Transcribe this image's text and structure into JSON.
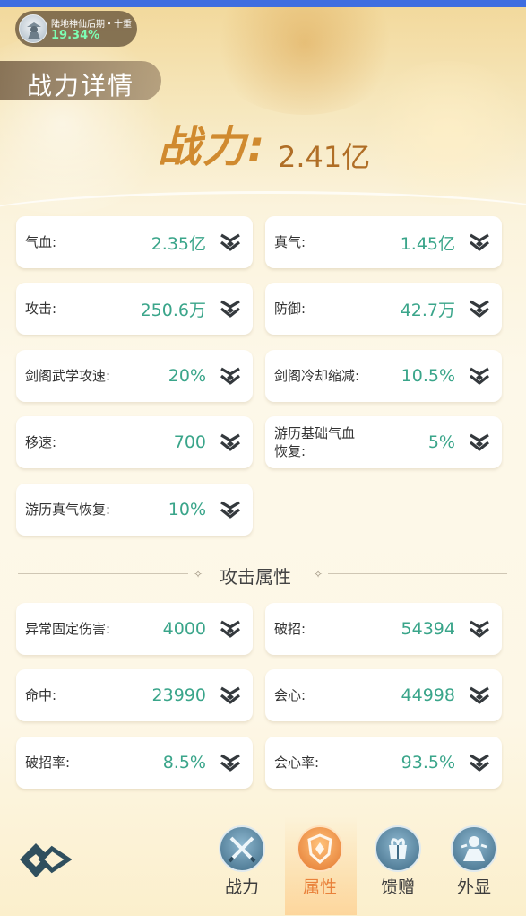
{
  "realm": {
    "name": "陆地神仙后期・十重",
    "percent": "19.34%"
  },
  "page_title": "战力详情",
  "power": {
    "label": "战力:",
    "value": "2.41亿"
  },
  "basic_stats": [
    {
      "label": "气血:",
      "value": "2.35亿"
    },
    {
      "label": "真气:",
      "value": "1.45亿"
    },
    {
      "label": "攻击:",
      "value": "250.6万"
    },
    {
      "label": "防御:",
      "value": "42.7万"
    },
    {
      "label": "剑阁武学攻速:",
      "value": "20%"
    },
    {
      "label": "剑阁冷却缩减:",
      "value": "10.5%"
    },
    {
      "label": "移速:",
      "value": "700"
    },
    {
      "label": "游历基础气血恢复:",
      "value": "5%"
    },
    {
      "label": "游历真气恢复:",
      "value": "10%"
    }
  ],
  "attack_section": {
    "title": "攻击属性",
    "stats": [
      {
        "label": "异常固定伤害:",
        "value": "4000"
      },
      {
        "label": "破招:",
        "value": "54394"
      },
      {
        "label": "命中:",
        "value": "23990"
      },
      {
        "label": "会心:",
        "value": "44998"
      },
      {
        "label": "破招率:",
        "value": "8.5%"
      },
      {
        "label": "会心率:",
        "value": "93.5%"
      }
    ]
  },
  "bottom_nav": [
    {
      "label": "战力",
      "icon": "swords-icon",
      "active": false
    },
    {
      "label": "属性",
      "icon": "shield-icon",
      "active": true
    },
    {
      "label": "馈赠",
      "icon": "gift-icon",
      "active": false
    },
    {
      "label": "外显",
      "icon": "appearance-icon",
      "active": false
    }
  ],
  "colors": {
    "value_green": "#3aa58a",
    "power_gold": "#d08a2f",
    "active_tab": "#e9813a",
    "top_bar": "#3f6ee0"
  }
}
